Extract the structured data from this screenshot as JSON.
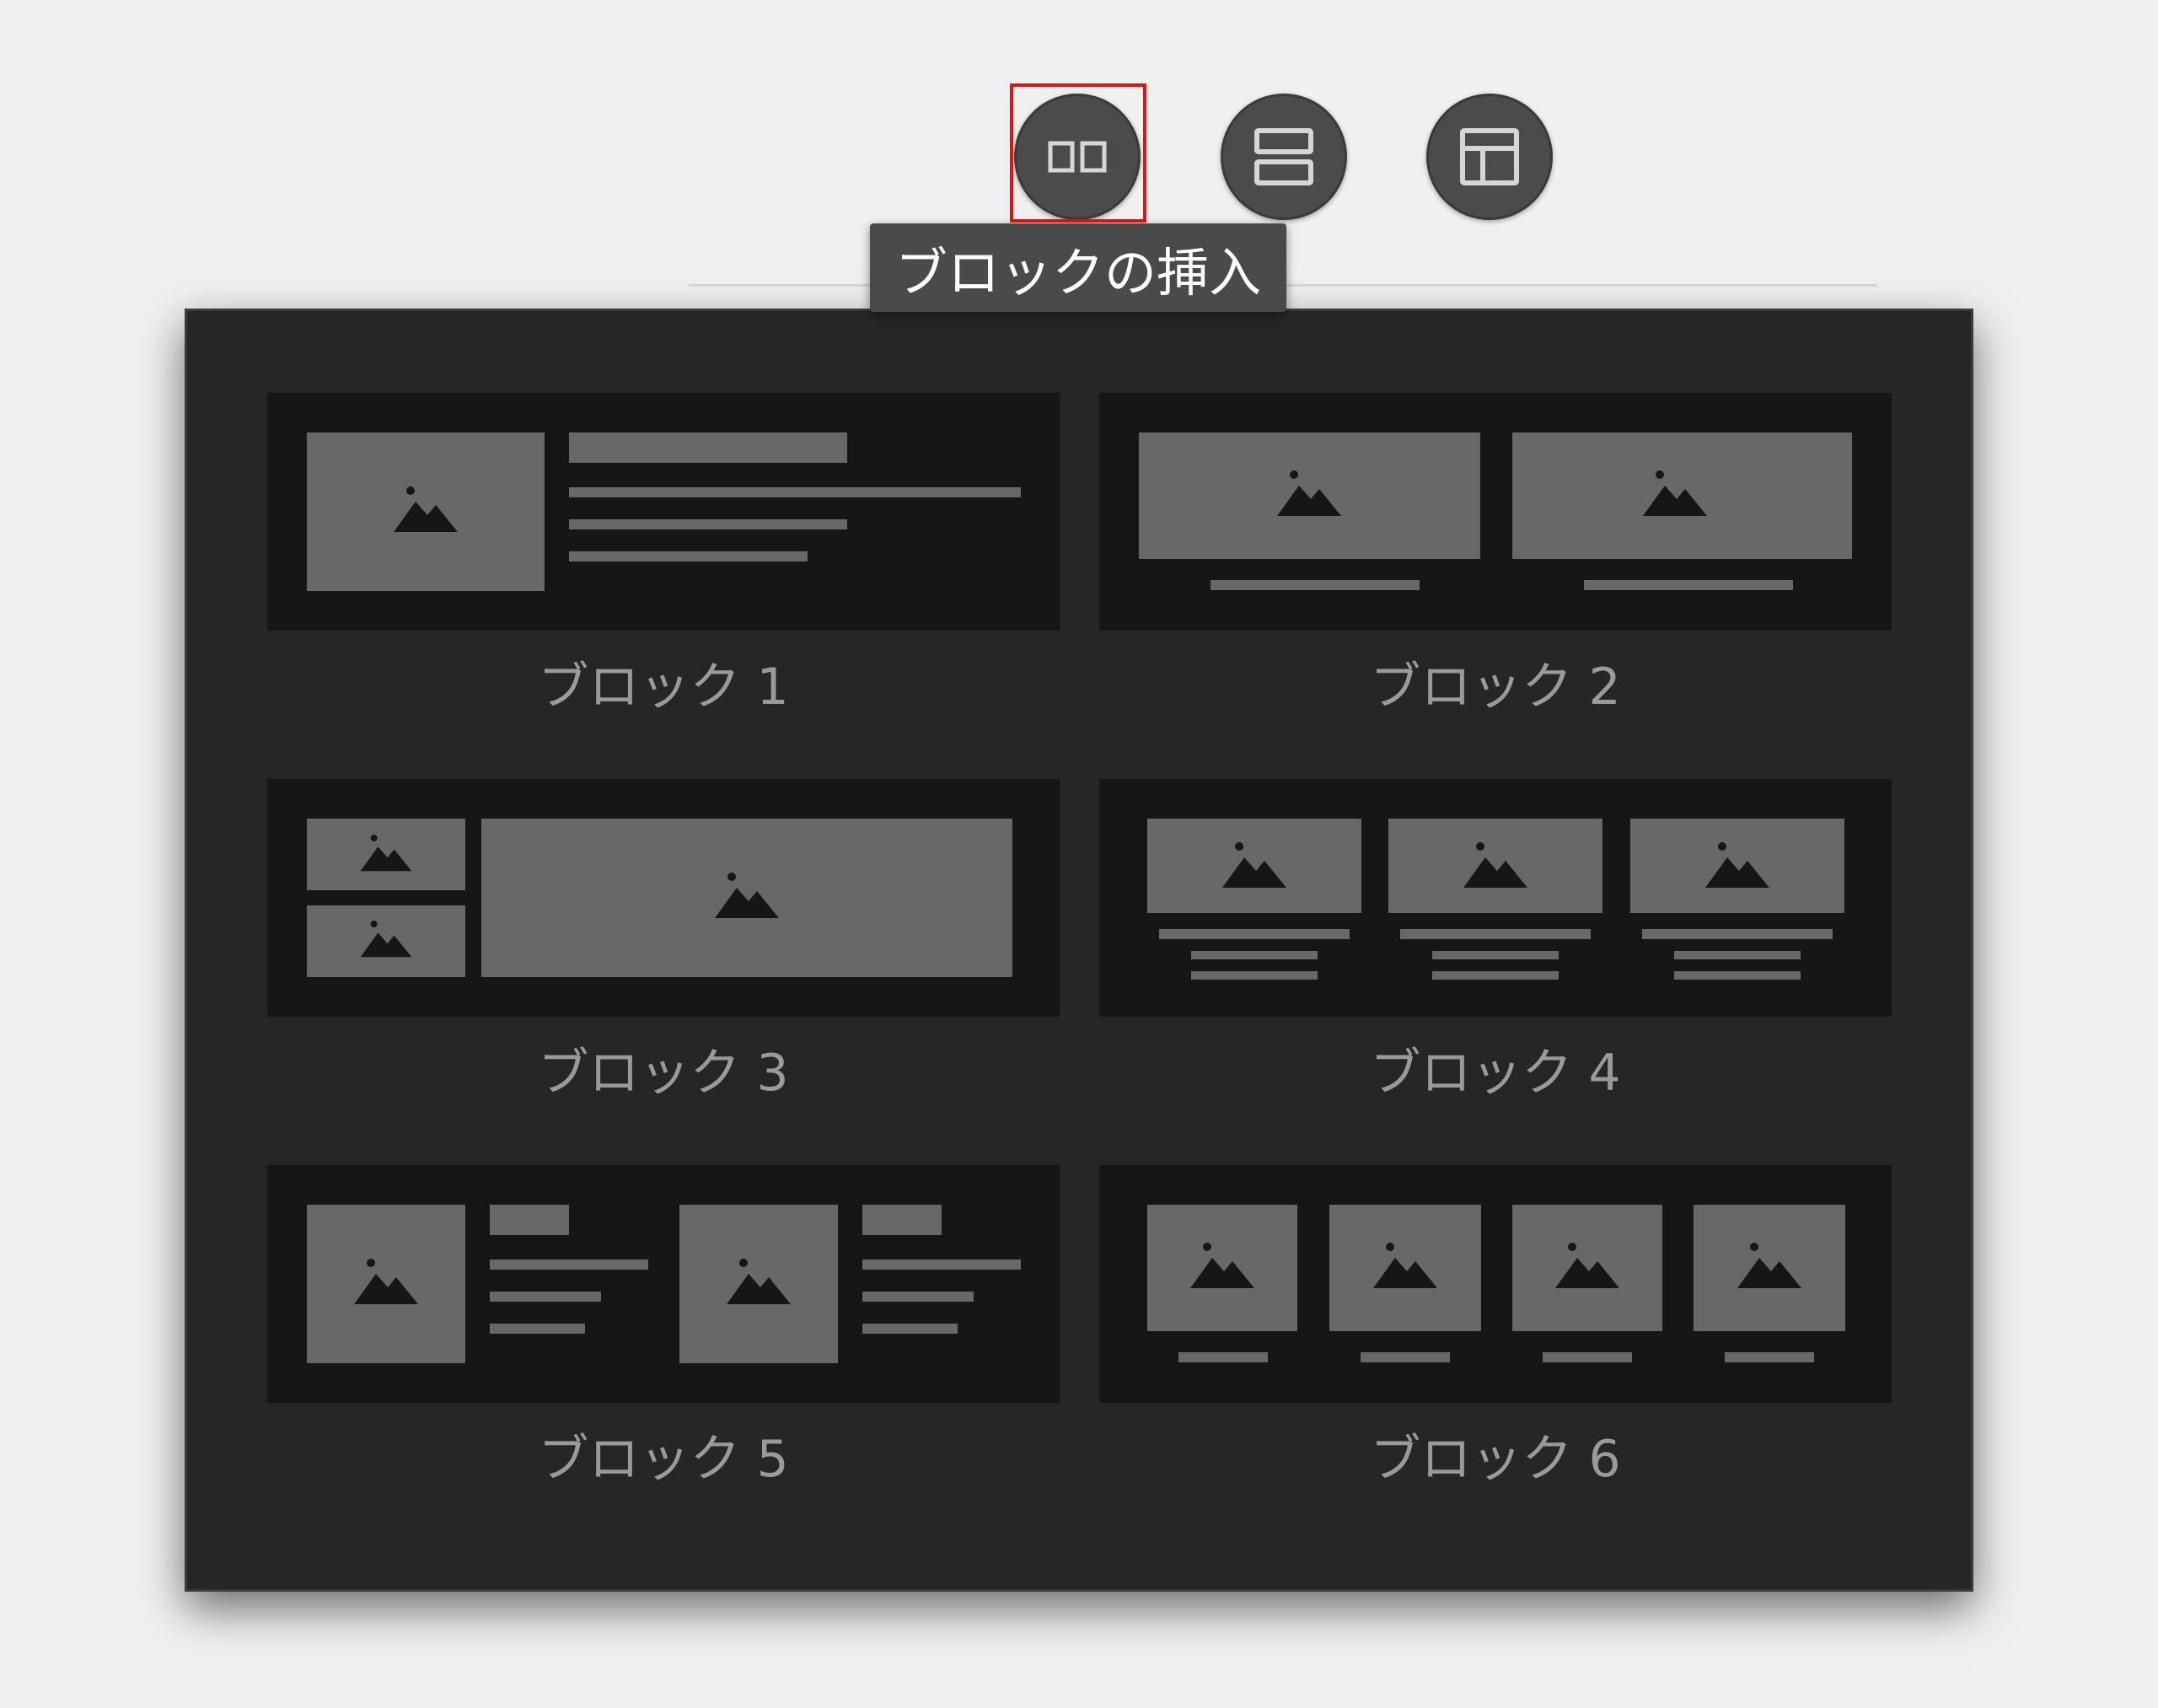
{
  "toolbar": {
    "buttons": [
      {
        "icon": "two-columns-icon"
      },
      {
        "icon": "two-rows-icon"
      },
      {
        "icon": "header-sidebar-layout-icon"
      }
    ]
  },
  "tooltip": {
    "text": "ブロックの挿入"
  },
  "panel": {
    "blocks": [
      {
        "label": "ブロック 1"
      },
      {
        "label": "ブロック 2"
      },
      {
        "label": "ブロック 3"
      },
      {
        "label": "ブロック 4"
      },
      {
        "label": "ブロック 5"
      },
      {
        "label": "ブロック 6"
      }
    ]
  },
  "colors": {
    "page_background": "#f0f0f0",
    "button": "#4b4b4b",
    "highlight": "#e11414",
    "panel": "#262626",
    "thumbnail": "#161616",
    "placeholder": "#686868",
    "label": "#9a9a9a"
  }
}
